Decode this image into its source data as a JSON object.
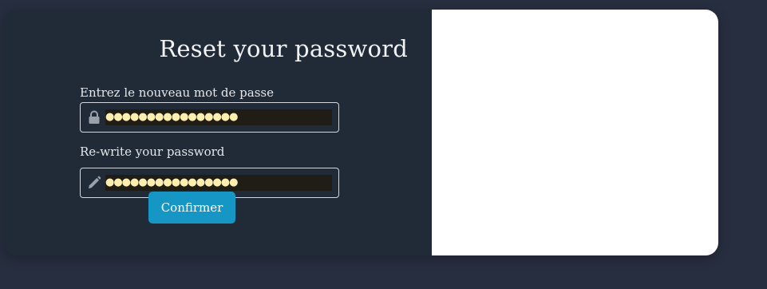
{
  "form": {
    "title": "Reset your password",
    "new_password_label": "Entrez le nouveau mot de passe",
    "new_password_value": "●●●●●●●●●●●●●●●●",
    "confirm_password_label": "Re-write your password",
    "confirm_password_value": "●●●●●●●●●●●●●●●●",
    "submit_label": "Confirmer"
  },
  "icons": {
    "new_password": "lock-icon",
    "confirm_password": "pencil-icon"
  },
  "colors": {
    "page_background": "#272e3f",
    "card_background": "#212b38",
    "side_panel": "#ffffff",
    "button": "#1596c4",
    "autofill_text": "#fbeeb0"
  }
}
